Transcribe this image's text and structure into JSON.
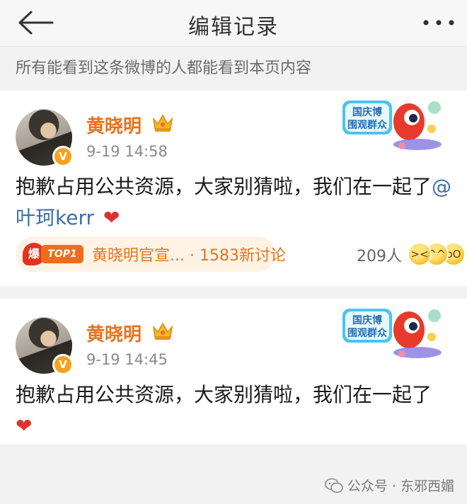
{
  "header": {
    "title": "编辑记录"
  },
  "notice": "所有能看到这条微博的人都能看到本页内容",
  "posts": [
    {
      "author": "黄晓明",
      "time": "9-19 14:58",
      "text": "抱歉占用公共资源，大家别猜啦，我们在一起了",
      "mention": "@叶珂kerr",
      "hot_tag": {
        "badge": "爆",
        "rank": "TOP1",
        "label": "黄晓明官宣...",
        "separator": " · ",
        "discussion": "1583新讨论"
      },
      "reaction_count": "209人"
    },
    {
      "author": "黄晓明",
      "time": "9-19 14:45",
      "text": "抱歉占用公共资源，大家别猜啦，我们在一起了"
    }
  ],
  "event_badge": {
    "line1": "国庆博",
    "line2": "围观群众"
  },
  "verified_mark": "V",
  "watermark": "公众号 · 东邪西媚",
  "colors": {
    "author": "#e8731c",
    "mention": "#3d6fa8",
    "heart": "#e03030",
    "hot_tag_bg": "#fff3e6",
    "page_bg": "#f2f2f2"
  },
  "icons": [
    "back-arrow-icon",
    "more-dots-icon",
    "verified-icon",
    "crown-icon",
    "heart-icon",
    "emoji-reaction-icon",
    "wechat-icon"
  ]
}
